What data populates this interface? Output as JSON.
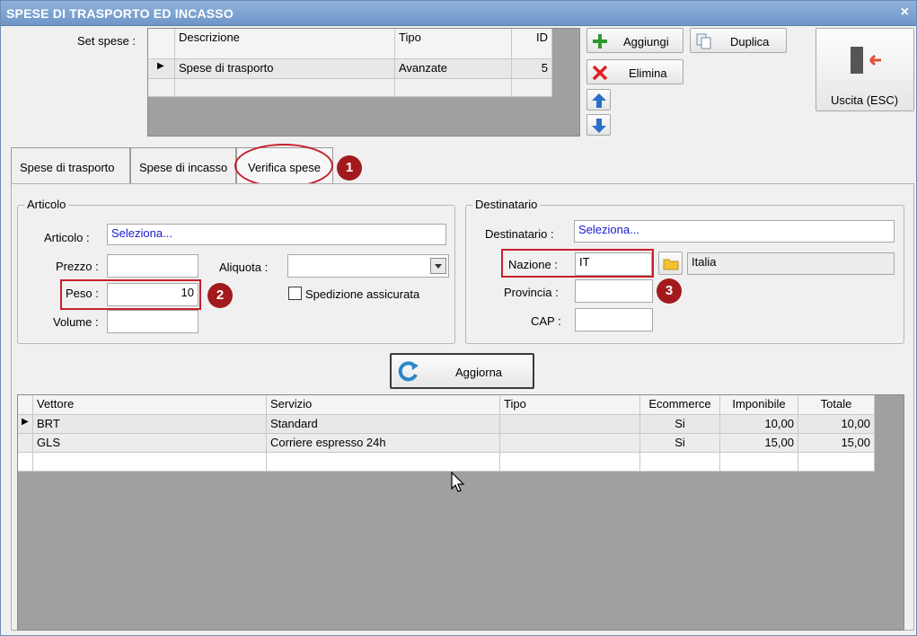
{
  "window": {
    "title": "SPESE DI TRASPORTO ED INCASSO",
    "close_glyph": "×"
  },
  "set_spese": {
    "label": "Set spese :",
    "columns": [
      "Descrizione",
      "Tipo",
      "ID"
    ],
    "rows": [
      {
        "descrizione": "Spese di trasporto",
        "tipo": "Avanzate",
        "id": "5"
      }
    ]
  },
  "toolbar": {
    "aggiungi": "Aggiungi",
    "duplica": "Duplica",
    "elimina": "Elimina",
    "uscita": "Uscita (ESC)"
  },
  "tabs": [
    {
      "label": "Spese di trasporto"
    },
    {
      "label": "Spese di incasso"
    },
    {
      "label": "Verifica spese"
    }
  ],
  "badges": [
    "1",
    "2",
    "3"
  ],
  "articolo": {
    "legend": "Articolo",
    "articolo_label": "Articolo :",
    "articolo_value": "Seleziona...",
    "prezzo_label": "Prezzo :",
    "prezzo_value": "",
    "peso_label": "Peso :",
    "peso_value": "10",
    "volume_label": "Volume :",
    "volume_value": "",
    "aliquota_label": "Aliquota :",
    "aliquota_value": "",
    "spedizione_label": "Spedizione assicurata",
    "spedizione_checked": false
  },
  "destinatario": {
    "legend": "Destinatario",
    "destinatario_label": "Destinatario :",
    "destinatario_value": "Seleziona...",
    "nazione_label": "Nazione :",
    "nazione_value": "IT",
    "nazione_name": "Italia",
    "provincia_label": "Provincia :",
    "provincia_value": "",
    "cap_label": "CAP :",
    "cap_value": ""
  },
  "aggiorna": "Aggiorna",
  "results": {
    "columns": [
      "Vettore",
      "Servizio",
      "Tipo",
      "Ecommerce",
      "Imponibile",
      "Totale"
    ],
    "rows": [
      {
        "vettore": "BRT",
        "servizio": "Standard",
        "tipo": "",
        "ecommerce": "Si",
        "imponibile": "10,00",
        "totale": "10,00"
      },
      {
        "vettore": "GLS",
        "servizio": "Corriere espresso 24h",
        "tipo": "",
        "ecommerce": "Si",
        "imponibile": "15,00",
        "totale": "15,00"
      }
    ]
  },
  "colors": {
    "accent_red": "#c8202a",
    "badge_red": "#a21a1e",
    "link_blue": "#1a1ad0",
    "title_blue": "#7aa0cf"
  }
}
